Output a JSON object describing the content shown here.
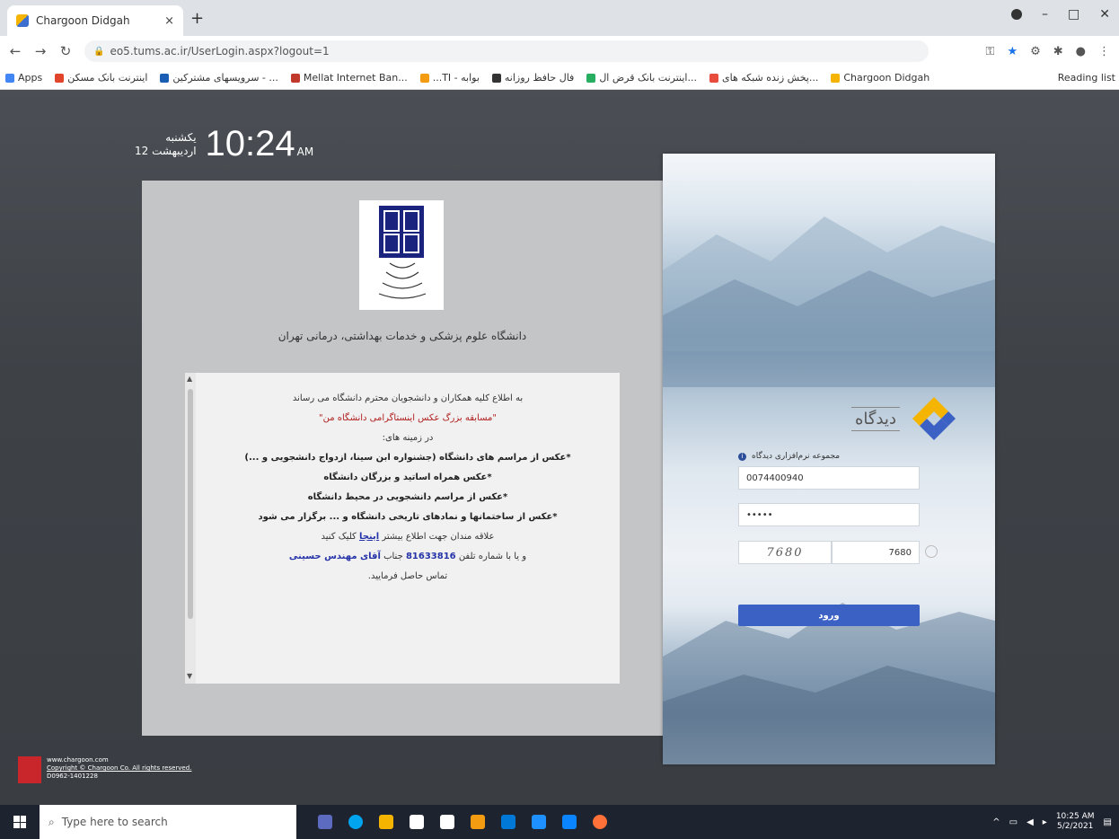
{
  "browser": {
    "tab_title": "Chargoon Didgah",
    "tab_close": "×",
    "new_tab": "+",
    "url": "eo5.tums.ac.ir/UserLogin.aspx?logout=1",
    "bookmarks": [
      {
        "label": "Apps",
        "color": "#4285f4"
      },
      {
        "label": "اینترنت بانک مسکن",
        "color": "#e0442b"
      },
      {
        "label": "سرویسهای مشترکین - ...",
        "color": "#1a5fb4"
      },
      {
        "label": "Mellat Internet Ban...",
        "color": "#c0392b"
      },
      {
        "label": "...TI - بوابه",
        "color": "#f39c12"
      },
      {
        "label": "فال حافظ روزانه",
        "color": "#333333"
      },
      {
        "label": "اینترنت بانک قرض ال...",
        "color": "#27ae60"
      },
      {
        "label": "پخش زنده شبکه های...",
        "color": "#e74c3c"
      },
      {
        "label": "Chargoon Didgah",
        "color": "#f5b400"
      }
    ],
    "reading_list": "Reading list"
  },
  "clock": {
    "day": "یکشنبه",
    "date": "12 اردیبهشت",
    "time": "10:24",
    "ampm": "AM"
  },
  "info": {
    "university_name": "دانشگاه علوم پزشکی و خدمات بهداشتی، درمانی تهران",
    "notice": {
      "line1": "به اطلاع کلیه همکاران و دانشجویان محترم دانشگاه می رساند",
      "line2": "\"مسابقه بزرگ عکس اینستاگرامی دانشگاه من\"",
      "line3": "در زمینه های:",
      "line4": "*عکس از مراسم های دانشگاه (جشنواره ابن سینا، ازدواج دانشجویی و ...)",
      "line5": "*عکس همراه اساتید و بزرگان دانشگاه",
      "line6": "*عکس از مراسم دانشجویی در محیط دانشگاه",
      "line7": "*عکس از ساختمانها و نمادهای تاریخی دانشگاه و ... برگزار می شود",
      "line8_pre": "علاقه مندان جهت اطلاع بیشتر",
      "line8_link": "اینجا",
      "line8_post": "کلیک کنید",
      "line9_pre": "و یا با شماره تلفن",
      "line9_phone": "81633816",
      "line9_mid": "جناب",
      "line9_name": "آقای مهندس حسینی",
      "line10": "تماس حاصل فرمایید."
    }
  },
  "login": {
    "brand": "دیدگاه",
    "user_label": "مجموعه نرم‌افزاری دیدگاه",
    "username": "0074400940",
    "password": "•••••",
    "captcha_text": "7680",
    "captcha_input": "7680",
    "button": "ورود"
  },
  "footer": {
    "site": "www.chargoon.com",
    "copyright": "Copyright © Chargoon Co. All rights reserved.",
    "version": "D0962-1401228"
  },
  "taskbar": {
    "search_placeholder": "Type here to search",
    "time": "10:25 AM",
    "date": "5/2/2021",
    "apps": [
      "#5c6bc0",
      "#00a4ef",
      "#f5b400",
      "#ffffff",
      "#ffffff",
      "#f39c12",
      "#0078d7",
      "#1e90ff",
      "#0a84ff",
      "#ff7139"
    ]
  },
  "colors": {
    "accent": "#3b61c4",
    "page_bg": "#3e4247"
  }
}
